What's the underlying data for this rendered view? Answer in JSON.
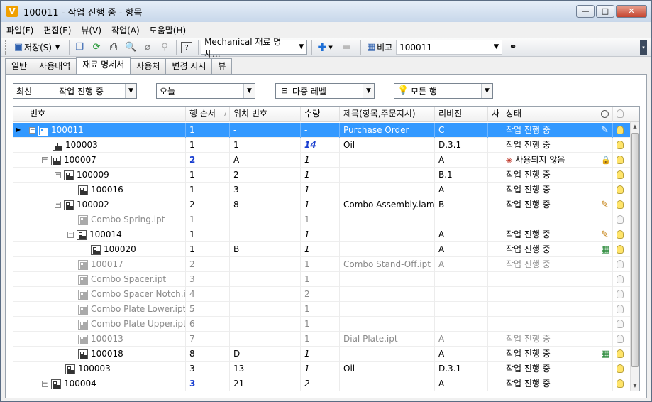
{
  "window": {
    "title": "100011 - 작업 진행 중 - 항목",
    "app_icon": "V",
    "minimize_label": "—",
    "maximize_label": "□",
    "close_label": "✕"
  },
  "menu": [
    "파일(F)",
    "편집(E)",
    "뷰(V)",
    "작업(A)",
    "도움말(H)"
  ],
  "toolbar": {
    "save_label": "저장(S)",
    "view_select": "Mechanical 재료 명세...",
    "compare_label": "비교",
    "compare_value": "100011"
  },
  "tabs": [
    "일반",
    "사용내역",
    "재료 명세서",
    "사용처",
    "변경 지시",
    "뷰"
  ],
  "active_tab": 2,
  "filters": {
    "revision_a": "최신",
    "revision_b": "작업 진행 중",
    "date": "오늘",
    "level": "다중 레벨",
    "rows": "모든 행"
  },
  "columns": [
    "번호",
    "행 순서",
    "위치 번호",
    "수량",
    "제목(항목,주문지시)",
    "리비전",
    "사",
    "상태"
  ],
  "rows": [
    {
      "number": "100011",
      "order": "1",
      "pos": "-",
      "qty": "-",
      "title": "Purchase Order",
      "rev": "C",
      "status": "작업 진행 중",
      "level": 0,
      "exp": "−",
      "icon": "assembly",
      "sel": true,
      "edit": true,
      "bulb": "on"
    },
    {
      "number": "100003",
      "order": "1",
      "pos": "1",
      "qty": "14",
      "title": "Oil",
      "rev": "D.3.1",
      "status": "작업 진행 중",
      "level": 1,
      "exp": "",
      "icon": "assembly",
      "qtyStyle": "blue",
      "bulb": "on"
    },
    {
      "number": "100007",
      "order": "2",
      "pos": "A",
      "qty": "1",
      "title": "",
      "rev": "A",
      "status": "사용되지 않음",
      "level": 1,
      "exp": "−",
      "icon": "assembly",
      "orderStyle": "blue",
      "qtyStyle": "ital",
      "stat": "diamond",
      "lock": true,
      "bulb": "on"
    },
    {
      "number": "100009",
      "order": "1",
      "pos": "2",
      "qty": "1",
      "title": "",
      "rev": "B.1",
      "status": "작업 진행 중",
      "level": 2,
      "exp": "−",
      "icon": "assembly",
      "qtyStyle": "ital",
      "bulb": "on"
    },
    {
      "number": "100016",
      "order": "1",
      "pos": "3",
      "qty": "1",
      "title": "",
      "rev": "A",
      "status": "작업 진행 중",
      "level": 3,
      "exp": "",
      "icon": "assembly",
      "qtyStyle": "ital",
      "bulb": "on"
    },
    {
      "number": "100002",
      "order": "2",
      "pos": "8",
      "qty": "1",
      "title": "Combo Assembly.iam",
      "rev": "B",
      "status": "작업 진행 중",
      "level": 2,
      "exp": "−",
      "icon": "assembly",
      "qtyStyle": "ital",
      "edit": true,
      "bulb": "on"
    },
    {
      "number": "Combo Spring.ipt",
      "order": "1",
      "pos": "",
      "qty": "1",
      "title": "",
      "rev": "",
      "status": "",
      "level": 3,
      "exp": "",
      "icon": "part",
      "gray": true,
      "bulb": "off"
    },
    {
      "number": "100014",
      "order": "1",
      "pos": "",
      "qty": "1",
      "title": "",
      "rev": "A",
      "status": "작업 진행 중",
      "level": 3,
      "exp": "−",
      "icon": "assembly",
      "qtyStyle": "ital",
      "edit": true,
      "bulb": "on"
    },
    {
      "number": "100020",
      "order": "1",
      "pos": "B",
      "qty": "1",
      "title": "",
      "rev": "A",
      "status": "작업 진행 중",
      "level": 4,
      "exp": "",
      "icon": "assembly",
      "qtyStyle": "ital",
      "newitem": true,
      "bulb": "on"
    },
    {
      "number": "100017",
      "order": "2",
      "pos": "",
      "qty": "1",
      "title": "Combo Stand-Off.ipt",
      "rev": "A",
      "status": "작업 진행 중",
      "level": 3,
      "exp": "",
      "icon": "assembly",
      "gray": true,
      "bulb": "off"
    },
    {
      "number": "Combo Spacer.ipt",
      "order": "3",
      "pos": "",
      "qty": "1",
      "title": "",
      "rev": "",
      "status": "",
      "level": 3,
      "exp": "",
      "icon": "part",
      "gray": true,
      "bulb": "off"
    },
    {
      "number": "Combo Spacer Notch.ipt",
      "order": "4",
      "pos": "",
      "qty": "2",
      "title": "",
      "rev": "",
      "status": "",
      "level": 3,
      "exp": "",
      "icon": "part",
      "gray": true,
      "bulb": "off"
    },
    {
      "number": "Combo Plate Lower.ipt",
      "order": "5",
      "pos": "",
      "qty": "1",
      "title": "",
      "rev": "",
      "status": "",
      "level": 3,
      "exp": "",
      "icon": "part",
      "gray": true,
      "bulb": "off"
    },
    {
      "number": "Combo Plate Upper.ipt",
      "order": "6",
      "pos": "",
      "qty": "1",
      "title": "",
      "rev": "",
      "status": "",
      "level": 3,
      "exp": "",
      "icon": "part",
      "gray": true,
      "bulb": "off"
    },
    {
      "number": "100013",
      "order": "7",
      "pos": "",
      "qty": "1",
      "title": "Dial Plate.ipt",
      "rev": "A",
      "status": "작업 진행 중",
      "level": 3,
      "exp": "",
      "icon": "assembly",
      "gray": true,
      "bulb": "off"
    },
    {
      "number": "100018",
      "order": "8",
      "pos": "D",
      "qty": "1",
      "title": "",
      "rev": "A",
      "status": "작업 진행 중",
      "level": 3,
      "exp": "",
      "icon": "assembly",
      "qtyStyle": "ital",
      "newitem": true,
      "bulb": "on"
    },
    {
      "number": "100003",
      "order": "3",
      "pos": "13",
      "qty": "1",
      "title": "Oil",
      "rev": "D.3.1",
      "status": "작업 진행 중",
      "level": 2,
      "exp": "",
      "icon": "assembly",
      "qtyStyle": "ital",
      "bulb": "on"
    },
    {
      "number": "100004",
      "order": "3",
      "pos": "21",
      "qty": "2",
      "title": "",
      "rev": "A",
      "status": "작업 진행 중",
      "level": 1,
      "exp": "−",
      "icon": "assembly",
      "orderStyle": "blue",
      "qtyStyle": "ital",
      "bulb": "on"
    }
  ]
}
